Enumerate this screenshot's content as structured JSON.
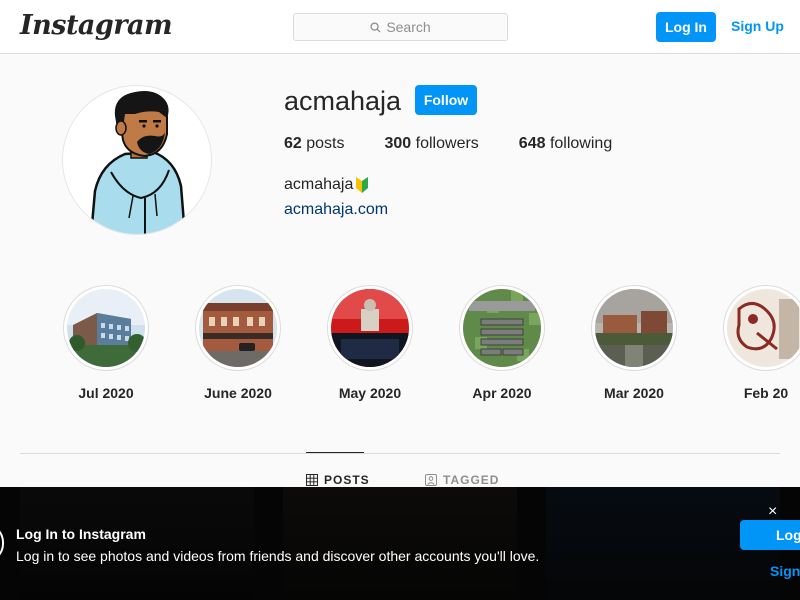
{
  "header": {
    "logo": "Instagram",
    "search_placeholder": "Search",
    "login_label": "Log In",
    "signup_label": "Sign Up"
  },
  "profile": {
    "username": "acmahaja",
    "follow_label": "Follow",
    "posts_count": "62",
    "posts_label": "posts",
    "followers_count": "300",
    "followers_label": "followers",
    "following_count": "648",
    "following_label": "following",
    "full_name": "acmahaja",
    "website": "acmahaja.com"
  },
  "highlights": [
    {
      "label": "Jul 2020"
    },
    {
      "label": "June 2020"
    },
    {
      "label": "May 2020"
    },
    {
      "label": "Apr 2020"
    },
    {
      "label": "Mar 2020"
    },
    {
      "label": "Feb 20"
    }
  ],
  "tabs": [
    {
      "label": "POSTS",
      "active": true
    },
    {
      "label": "TAGGED",
      "active": false
    }
  ],
  "login_banner": {
    "title": "Log In to Instagram",
    "text": "Log in to see photos and videos from friends and discover other accounts you'll love.",
    "login_label": "Log",
    "signup_label": "Sign",
    "close_symbol": "×"
  },
  "colors": {
    "accent": "#0095f6",
    "link": "#00376b",
    "text": "#262626",
    "muted": "#8e8e8e",
    "border": "#dbdbdb",
    "background": "#fafafa"
  }
}
